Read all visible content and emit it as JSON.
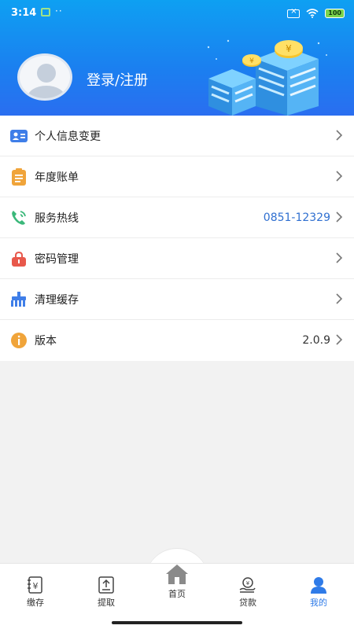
{
  "status_bar": {
    "time": "3:14",
    "dots": "··",
    "battery": "100"
  },
  "profile": {
    "login_label": "登录/注册"
  },
  "menu": {
    "items": [
      {
        "label": "个人信息变更",
        "value": "",
        "icon": "id-card-icon"
      },
      {
        "label": "年度账单",
        "value": "",
        "icon": "bill-icon"
      },
      {
        "label": "服务热线",
        "value": "0851-12329",
        "icon": "phone-icon"
      },
      {
        "label": "密码管理",
        "value": "",
        "icon": "lock-icon"
      },
      {
        "label": "清理缓存",
        "value": "",
        "icon": "broom-icon"
      },
      {
        "label": "版本",
        "value": "2.0.9",
        "icon": "info-icon"
      }
    ]
  },
  "tabbar": {
    "tabs": [
      {
        "label": "缴存",
        "icon": "deposit-icon"
      },
      {
        "label": "提取",
        "icon": "withdraw-icon"
      },
      {
        "label": "首页",
        "icon": "home-icon"
      },
      {
        "label": "贷款",
        "icon": "loan-icon"
      },
      {
        "label": "我的",
        "icon": "user-icon"
      }
    ],
    "active_index": 4
  },
  "colors": {
    "header_start": "#0ea0f2",
    "header_end": "#2a6ef0",
    "accent": "#2f7be8",
    "hotline": "#2f6fd0"
  }
}
